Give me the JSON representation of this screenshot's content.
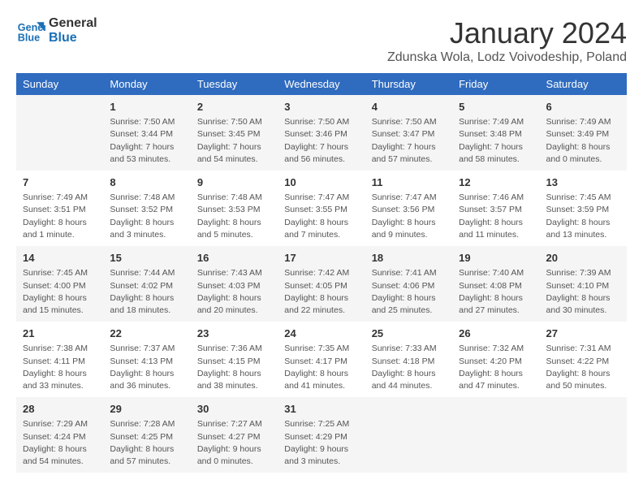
{
  "logo": {
    "line1": "General",
    "line2": "Blue"
  },
  "title": "January 2024",
  "subtitle": "Zdunska Wola, Lodz Voivodeship, Poland",
  "weekdays": [
    "Sunday",
    "Monday",
    "Tuesday",
    "Wednesday",
    "Thursday",
    "Friday",
    "Saturday"
  ],
  "weeks": [
    [
      {
        "day": "",
        "info": ""
      },
      {
        "day": "1",
        "info": "Sunrise: 7:50 AM\nSunset: 3:44 PM\nDaylight: 7 hours\nand 53 minutes."
      },
      {
        "day": "2",
        "info": "Sunrise: 7:50 AM\nSunset: 3:45 PM\nDaylight: 7 hours\nand 54 minutes."
      },
      {
        "day": "3",
        "info": "Sunrise: 7:50 AM\nSunset: 3:46 PM\nDaylight: 7 hours\nand 56 minutes."
      },
      {
        "day": "4",
        "info": "Sunrise: 7:50 AM\nSunset: 3:47 PM\nDaylight: 7 hours\nand 57 minutes."
      },
      {
        "day": "5",
        "info": "Sunrise: 7:49 AM\nSunset: 3:48 PM\nDaylight: 7 hours\nand 58 minutes."
      },
      {
        "day": "6",
        "info": "Sunrise: 7:49 AM\nSunset: 3:49 PM\nDaylight: 8 hours\nand 0 minutes."
      }
    ],
    [
      {
        "day": "7",
        "info": "Sunrise: 7:49 AM\nSunset: 3:51 PM\nDaylight: 8 hours\nand 1 minute."
      },
      {
        "day": "8",
        "info": "Sunrise: 7:48 AM\nSunset: 3:52 PM\nDaylight: 8 hours\nand 3 minutes."
      },
      {
        "day": "9",
        "info": "Sunrise: 7:48 AM\nSunset: 3:53 PM\nDaylight: 8 hours\nand 5 minutes."
      },
      {
        "day": "10",
        "info": "Sunrise: 7:47 AM\nSunset: 3:55 PM\nDaylight: 8 hours\nand 7 minutes."
      },
      {
        "day": "11",
        "info": "Sunrise: 7:47 AM\nSunset: 3:56 PM\nDaylight: 8 hours\nand 9 minutes."
      },
      {
        "day": "12",
        "info": "Sunrise: 7:46 AM\nSunset: 3:57 PM\nDaylight: 8 hours\nand 11 minutes."
      },
      {
        "day": "13",
        "info": "Sunrise: 7:45 AM\nSunset: 3:59 PM\nDaylight: 8 hours\nand 13 minutes."
      }
    ],
    [
      {
        "day": "14",
        "info": "Sunrise: 7:45 AM\nSunset: 4:00 PM\nDaylight: 8 hours\nand 15 minutes."
      },
      {
        "day": "15",
        "info": "Sunrise: 7:44 AM\nSunset: 4:02 PM\nDaylight: 8 hours\nand 18 minutes."
      },
      {
        "day": "16",
        "info": "Sunrise: 7:43 AM\nSunset: 4:03 PM\nDaylight: 8 hours\nand 20 minutes."
      },
      {
        "day": "17",
        "info": "Sunrise: 7:42 AM\nSunset: 4:05 PM\nDaylight: 8 hours\nand 22 minutes."
      },
      {
        "day": "18",
        "info": "Sunrise: 7:41 AM\nSunset: 4:06 PM\nDaylight: 8 hours\nand 25 minutes."
      },
      {
        "day": "19",
        "info": "Sunrise: 7:40 AM\nSunset: 4:08 PM\nDaylight: 8 hours\nand 27 minutes."
      },
      {
        "day": "20",
        "info": "Sunrise: 7:39 AM\nSunset: 4:10 PM\nDaylight: 8 hours\nand 30 minutes."
      }
    ],
    [
      {
        "day": "21",
        "info": "Sunrise: 7:38 AM\nSunset: 4:11 PM\nDaylight: 8 hours\nand 33 minutes."
      },
      {
        "day": "22",
        "info": "Sunrise: 7:37 AM\nSunset: 4:13 PM\nDaylight: 8 hours\nand 36 minutes."
      },
      {
        "day": "23",
        "info": "Sunrise: 7:36 AM\nSunset: 4:15 PM\nDaylight: 8 hours\nand 38 minutes."
      },
      {
        "day": "24",
        "info": "Sunrise: 7:35 AM\nSunset: 4:17 PM\nDaylight: 8 hours\nand 41 minutes."
      },
      {
        "day": "25",
        "info": "Sunrise: 7:33 AM\nSunset: 4:18 PM\nDaylight: 8 hours\nand 44 minutes."
      },
      {
        "day": "26",
        "info": "Sunrise: 7:32 AM\nSunset: 4:20 PM\nDaylight: 8 hours\nand 47 minutes."
      },
      {
        "day": "27",
        "info": "Sunrise: 7:31 AM\nSunset: 4:22 PM\nDaylight: 8 hours\nand 50 minutes."
      }
    ],
    [
      {
        "day": "28",
        "info": "Sunrise: 7:29 AM\nSunset: 4:24 PM\nDaylight: 8 hours\nand 54 minutes."
      },
      {
        "day": "29",
        "info": "Sunrise: 7:28 AM\nSunset: 4:25 PM\nDaylight: 8 hours\nand 57 minutes."
      },
      {
        "day": "30",
        "info": "Sunrise: 7:27 AM\nSunset: 4:27 PM\nDaylight: 9 hours\nand 0 minutes."
      },
      {
        "day": "31",
        "info": "Sunrise: 7:25 AM\nSunset: 4:29 PM\nDaylight: 9 hours\nand 3 minutes."
      },
      {
        "day": "",
        "info": ""
      },
      {
        "day": "",
        "info": ""
      },
      {
        "day": "",
        "info": ""
      }
    ]
  ]
}
